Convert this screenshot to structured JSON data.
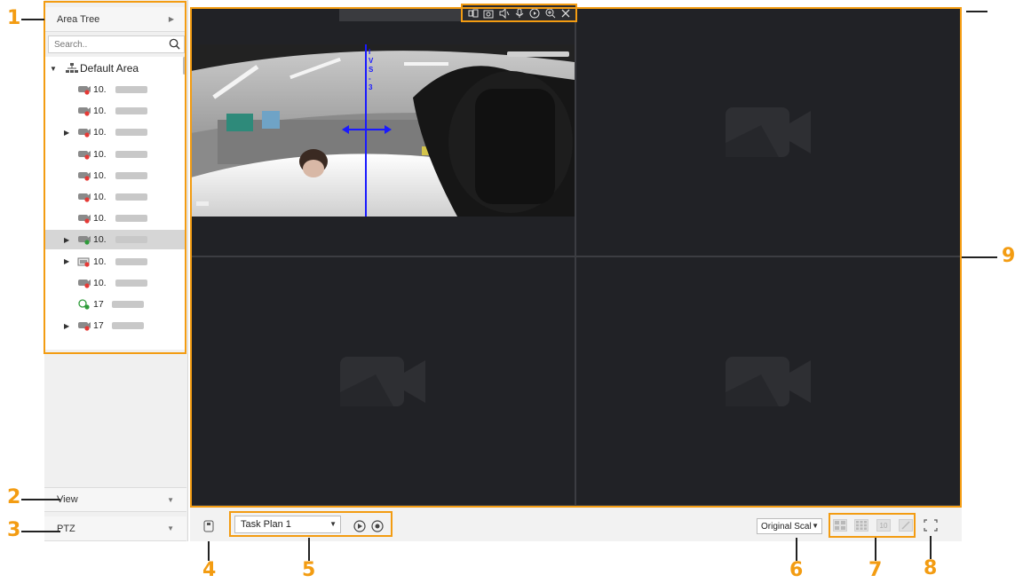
{
  "sidebar": {
    "area_tree_label": "Area Tree",
    "search_placeholder": "Search..",
    "root_label": "Default Area",
    "devices": [
      {
        "prefix": "10.",
        "status": "offline",
        "expandable": false,
        "type": "camera"
      },
      {
        "prefix": "10.",
        "status": "offline",
        "expandable": false,
        "type": "camera"
      },
      {
        "prefix": "10.",
        "status": "offline",
        "expandable": true,
        "type": "camera"
      },
      {
        "prefix": "10.",
        "status": "offline",
        "expandable": false,
        "type": "camera"
      },
      {
        "prefix": "10.",
        "status": "offline",
        "expandable": false,
        "type": "camera"
      },
      {
        "prefix": "10.",
        "status": "offline",
        "expandable": false,
        "type": "camera"
      },
      {
        "prefix": "10.",
        "status": "offline",
        "expandable": false,
        "type": "camera"
      },
      {
        "prefix": "10.",
        "status": "online",
        "expandable": true,
        "type": "camera",
        "selected": true
      },
      {
        "prefix": "10.",
        "status": "offline",
        "expandable": true,
        "type": "nvr"
      },
      {
        "prefix": "10.",
        "status": "offline",
        "expandable": false,
        "type": "camera"
      },
      {
        "prefix": "17",
        "status": "online",
        "expandable": false,
        "type": "search-camera"
      },
      {
        "prefix": "17",
        "status": "offline",
        "expandable": true,
        "type": "camera"
      }
    ],
    "view_label": "View",
    "ptz_label": "PTZ"
  },
  "video": {
    "ivs_label": "IVS",
    "ivs_number": "3",
    "pane_toolbar_icons": [
      "switch-stream-icon",
      "snapshot-icon",
      "audio-icon",
      "talk-icon",
      "record-icon",
      "zoom-icon",
      "close-icon"
    ]
  },
  "bottom_bar": {
    "task_plan_value": "Task Plan 1",
    "scale_value": "Original Scale",
    "layout_label_10": "10"
  },
  "annotations": [
    "1",
    "2",
    "3",
    "4",
    "5",
    "6",
    "7",
    "8",
    "9"
  ],
  "colors": {
    "annotation": "#f39c12",
    "video_bg": "#1e1f22",
    "ivs_line": "#1a1aff",
    "offline_badge": "#e53935",
    "online_badge": "#2e9b3a"
  }
}
